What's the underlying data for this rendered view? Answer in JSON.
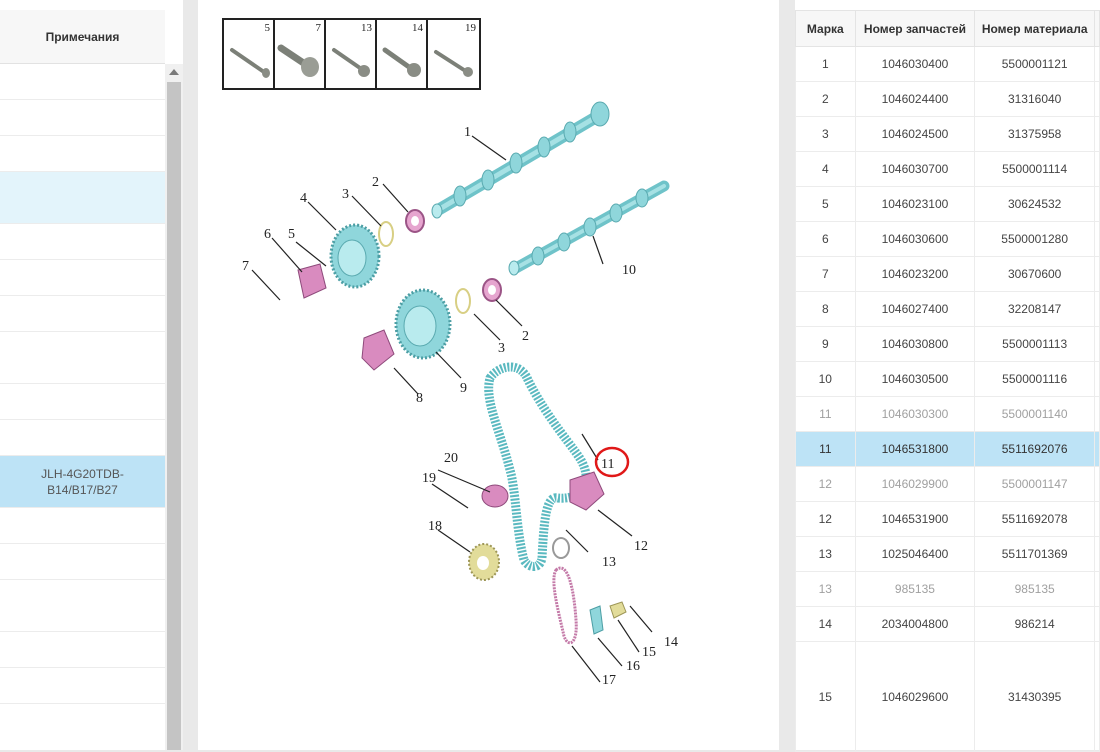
{
  "left_panel": {
    "header": "Примечания",
    "rows": [
      {
        "text": "",
        "h": 36
      },
      {
        "text": "",
        "h": 36
      },
      {
        "text": "",
        "h": 36
      },
      {
        "text": "",
        "h": 52,
        "hl": true
      },
      {
        "text": "",
        "h": 36
      },
      {
        "text": "",
        "h": 36
      },
      {
        "text": "",
        "h": 36
      },
      {
        "text": "",
        "h": 52
      },
      {
        "text": "",
        "h": 36
      },
      {
        "text": "",
        "h": 36
      },
      {
        "text": "JLH-4G20TDB-B14/B17/B27",
        "h": 52,
        "sel": true
      },
      {
        "text": "",
        "h": 36
      },
      {
        "text": "",
        "h": 36
      },
      {
        "text": "",
        "h": 52
      },
      {
        "text": "",
        "h": 36
      },
      {
        "text": "",
        "h": 36
      }
    ]
  },
  "bolt_strip": [
    "5",
    "7",
    "13",
    "14",
    "19"
  ],
  "diagram_labels": {
    "l1": "1",
    "l2a": "2",
    "l2b": "2",
    "l3a": "3",
    "l3b": "3",
    "l4": "4",
    "l5": "5",
    "l6": "6",
    "l7": "7",
    "l8": "8",
    "l9": "9",
    "l10": "10",
    "l11": "11",
    "l12": "12",
    "l13": "13",
    "l14": "14",
    "l15": "15",
    "l16": "16",
    "l17": "17",
    "l18": "18",
    "l19": "19",
    "l20": "20"
  },
  "parts_table": {
    "headers": [
      "Марка",
      "Номер запчастей",
      "Номер материала"
    ],
    "rows": [
      {
        "mark": "1",
        "part": "1046030400",
        "material": "5500001121"
      },
      {
        "mark": "2",
        "part": "1046024400",
        "material": "31316040"
      },
      {
        "mark": "3",
        "part": "1046024500",
        "material": "31375958"
      },
      {
        "mark": "4",
        "part": "1046030700",
        "material": "5500001114"
      },
      {
        "mark": "5",
        "part": "1046023100",
        "material": "30624532"
      },
      {
        "mark": "6",
        "part": "1046030600",
        "material": "5500001280"
      },
      {
        "mark": "7",
        "part": "1046023200",
        "material": "30670600"
      },
      {
        "mark": "8",
        "part": "1046027400",
        "material": "32208147"
      },
      {
        "mark": "9",
        "part": "1046030800",
        "material": "5500001113"
      },
      {
        "mark": "10",
        "part": "1046030500",
        "material": "5500001116"
      },
      {
        "mark": "11",
        "part": "1046030300",
        "material": "5500001140",
        "state": "dim"
      },
      {
        "mark": "11",
        "part": "1046531800",
        "material": "5511692076",
        "state": "sel"
      },
      {
        "mark": "12",
        "part": "1046029900",
        "material": "5500001147",
        "state": "dim"
      },
      {
        "mark": "12",
        "part": "1046531900",
        "material": "5511692078"
      },
      {
        "mark": "13",
        "part": "1025046400",
        "material": "5511701369"
      },
      {
        "mark": "13",
        "part": "985135",
        "material": "985135",
        "state": "dim"
      },
      {
        "mark": "14",
        "part": "2034004800",
        "material": "986214"
      },
      {
        "mark": "15",
        "part": "1046029600",
        "material": "31430395",
        "state": "tall"
      }
    ]
  },
  "colors": {
    "accent_selected": "#bde3f6",
    "highlight": "#e3f4fb",
    "annotation_red": "#e01818",
    "camshaft": "#8fd6db",
    "sprocket_pink": "#d98bbf",
    "idler_yellow": "#e2dc9a"
  }
}
